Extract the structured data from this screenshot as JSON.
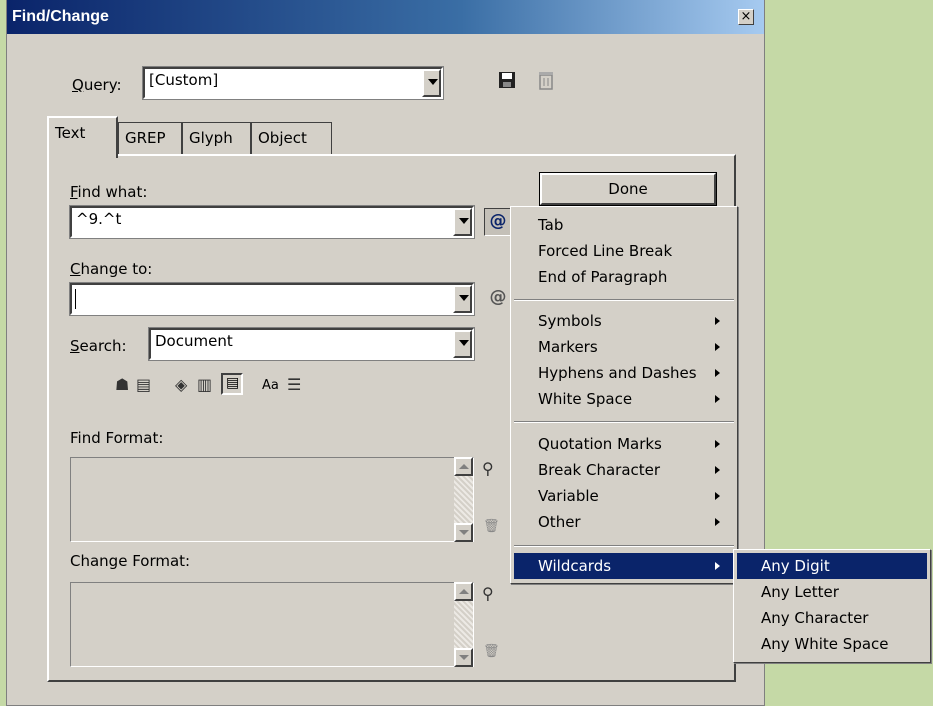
{
  "window": {
    "title": "Find/Change",
    "close_glyph": "×"
  },
  "query": {
    "label_u": "Q",
    "label_rest": "uery:",
    "value": "[Custom]"
  },
  "tabs": [
    {
      "label": "Text",
      "active": true
    },
    {
      "label": "GREP",
      "active": false
    },
    {
      "label": "Glyph",
      "active": false
    },
    {
      "label": "Object",
      "active": false
    }
  ],
  "find": {
    "label_u": "F",
    "label_rest": "ind what:",
    "value": "^9.^t"
  },
  "change": {
    "label_u": "C",
    "label_rest": "hange to:",
    "value": ""
  },
  "search": {
    "label_u": "S",
    "label_rest": "earch:",
    "value": "Document"
  },
  "done_button": "Done",
  "find_format_label": "Find Format:",
  "change_format_label": "Change Format:",
  "options_icons": [
    "locked-layers-icon",
    "locked-stories-icon",
    "hidden-layers-icon",
    "master-pages-icon",
    "footnotes-icon",
    "case-sensitive-icon",
    "whole-word-icon"
  ],
  "case_sensitive_text": "Aa",
  "special_char_menu": {
    "items": [
      {
        "label": "Tab",
        "submenu": false
      },
      {
        "label": "Forced Line Break",
        "submenu": false
      },
      {
        "label": "End of Paragraph",
        "submenu": false
      },
      {
        "sep": true
      },
      {
        "label": "Symbols",
        "submenu": true
      },
      {
        "label": "Markers",
        "submenu": true
      },
      {
        "label": "Hyphens and Dashes",
        "submenu": true
      },
      {
        "label": "White Space",
        "submenu": true
      },
      {
        "sep": true
      },
      {
        "label": "Quotation Marks",
        "submenu": true
      },
      {
        "label": "Break Character",
        "submenu": true
      },
      {
        "label": "Variable",
        "submenu": true
      },
      {
        "label": "Other",
        "submenu": true
      },
      {
        "sep": true
      },
      {
        "label": "Wildcards",
        "submenu": true,
        "highlighted": true
      }
    ]
  },
  "wildcards_submenu": {
    "items": [
      {
        "label": "Any Digit",
        "highlighted": true
      },
      {
        "label": "Any Letter"
      },
      {
        "label": "Any Character"
      },
      {
        "label": "Any White Space"
      }
    ]
  },
  "colors": {
    "highlight": "#0a246a",
    "dialog_bg": "#d4d0c8",
    "desktop": "#c5d9a6"
  }
}
